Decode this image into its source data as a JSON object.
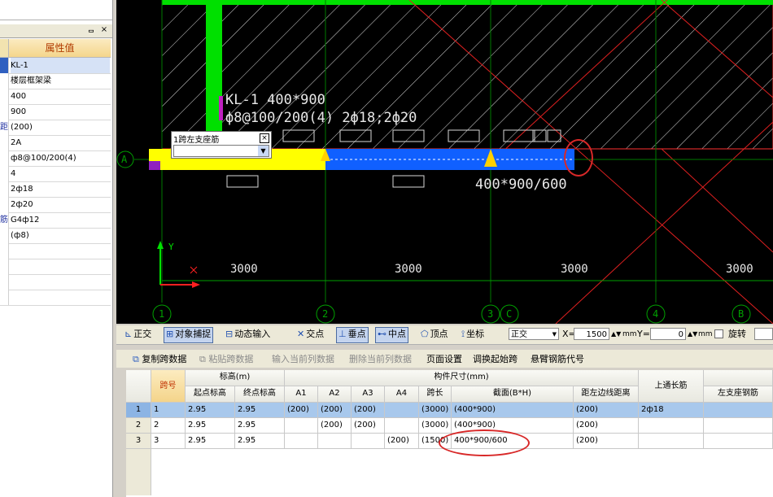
{
  "left_panel": {
    "pin_glyph": "ᆷ",
    "close_glyph": "×",
    "header_value": "属性值",
    "rows": [
      {
        "name": "",
        "value": "KL-1",
        "selected": true
      },
      {
        "name": "",
        "value": "楼层框架梁"
      },
      {
        "name": "",
        "value": "400"
      },
      {
        "name": "",
        "value": "900"
      },
      {
        "name": "距",
        "value": "(200)"
      },
      {
        "name": "",
        "value": "2A"
      },
      {
        "name": "",
        "value": "ф8@100/200(4)"
      },
      {
        "name": "",
        "value": "4"
      },
      {
        "name": "",
        "value": "2ф18"
      },
      {
        "name": "",
        "value": "2ф20"
      },
      {
        "name": "筋",
        "value": "G4ф12"
      },
      {
        "name": "",
        "value": "(ф8)"
      },
      {
        "name": "",
        "value": ""
      },
      {
        "name": "",
        "value": ""
      },
      {
        "name": "",
        "value": ""
      },
      {
        "name": "",
        "value": ""
      }
    ]
  },
  "cad": {
    "beam_label_line1": "KL-1 400*900",
    "beam_label_line2": "ф8@100/200(4) 2ф18;2ф20",
    "span_section_label": "400*900/600",
    "axis_row_label": "A",
    "dims": [
      "3000",
      "3000",
      "3000",
      "3000"
    ],
    "axis_cols": [
      "1",
      "2",
      "3",
      "C",
      "4",
      "B"
    ],
    "ucs_x": "X",
    "ucs_y": "Y",
    "popup_title": "1跨左支座筋",
    "popup_close": "×",
    "popup_arrow": "▼"
  },
  "snapbar": {
    "ortho": "正交",
    "object_snap": "对象捕捉",
    "dynamic_input": "动态输入",
    "intersection": "交点",
    "perpendicular": "垂点",
    "midpoint": "中点",
    "vertex": "顶点",
    "coordinate": "坐标",
    "mode_value": "正交",
    "x_label": "X=",
    "x_value": "1500",
    "y_label": "Y=",
    "y_value": "0",
    "unit": "mm",
    "rotate": "旋转"
  },
  "tablebar": {
    "copy_span": "复制跨数据",
    "paste_span": "粘贴跨数据",
    "input_col": "输入当前列数据",
    "delete_col": "删除当前列数据",
    "page_setup": "页面设置",
    "swap_start": "调换起始跨",
    "cantilever": "悬臂钢筋代号"
  },
  "grid": {
    "headers": {
      "span_no": "跨号",
      "elevation": "标高(m)",
      "start_elev": "起点标高",
      "end_elev": "终点标高",
      "member_size": "构件尺寸(mm)",
      "a1": "A1",
      "a2": "A2",
      "a3": "A3",
      "a4": "A4",
      "span_len": "跨长",
      "section": "截面(B*H)",
      "left_edge": "距左边线距离",
      "top_through": "上通长筋",
      "left_support": "左支座钢筋"
    },
    "rows": [
      {
        "n": "1",
        "span": "1",
        "start": "2.95",
        "end": "2.95",
        "a1": "(200)",
        "a2": "(200)",
        "a3": "(200)",
        "a4": "",
        "len": "(3000)",
        "section": "(400*900)",
        "edge": "(200)",
        "top": "2ф18",
        "left": "",
        "selected": true
      },
      {
        "n": "2",
        "span": "2",
        "start": "2.95",
        "end": "2.95",
        "a1": "",
        "a2": "(200)",
        "a3": "(200)",
        "a4": "",
        "len": "(3000)",
        "section": "(400*900)",
        "edge": "(200)",
        "top": "",
        "left": ""
      },
      {
        "n": "3",
        "span": "3",
        "start": "2.95",
        "end": "2.95",
        "a1": "",
        "a2": "",
        "a3": "",
        "a4": "(200)",
        "len": "(1500)",
        "section": "400*900/600",
        "edge": "(200)",
        "top": "",
        "left": ""
      }
    ]
  },
  "colors": {
    "canvas_bg": "#000000",
    "column_green": "#00e000",
    "beam_yellow": "#ffff00",
    "beam_blue": "#1060ff",
    "annotation_red": "#d82828",
    "selected_row": "#a8c8ec"
  }
}
